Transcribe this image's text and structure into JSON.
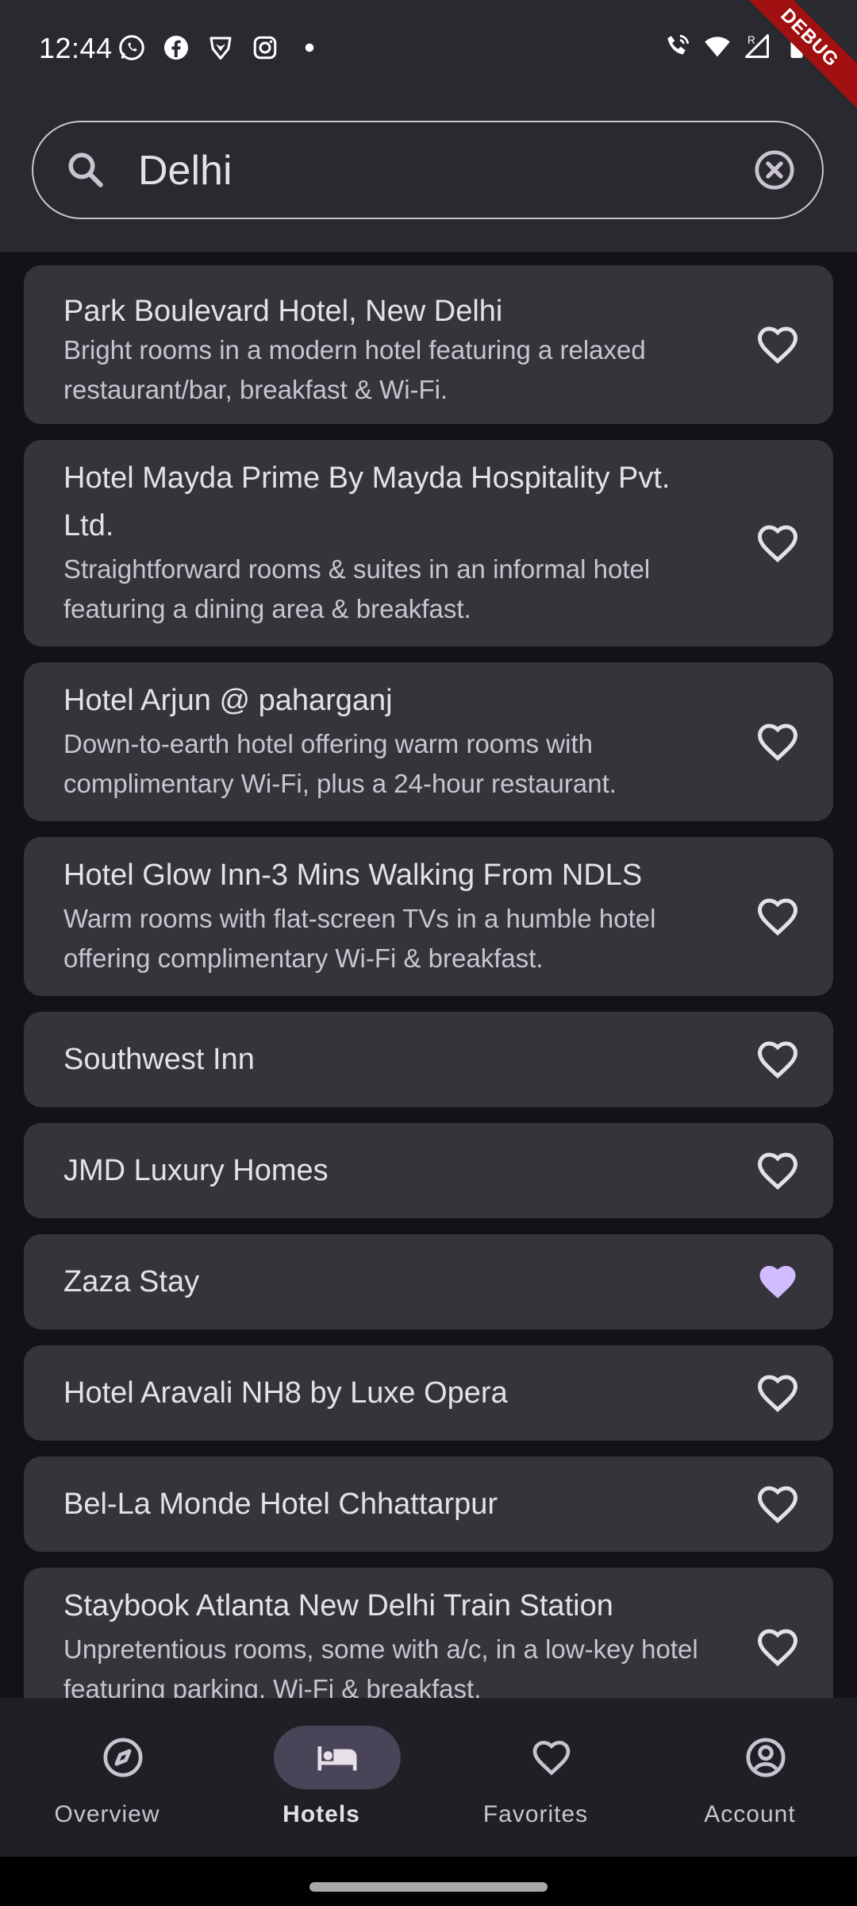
{
  "status_bar": {
    "time": "12:44",
    "left_icons": [
      "whatsapp-icon",
      "facebook-icon",
      "brave-icon",
      "instagram-icon",
      "dot-icon"
    ],
    "right_icons": [
      "wifi-call-icon",
      "wifi-icon",
      "signal-icon",
      "battery-icon"
    ],
    "debug_label": "DEBUG"
  },
  "search": {
    "value": "Delhi",
    "icon": "search-icon",
    "clear_icon": "clear-icon"
  },
  "hotels": [
    {
      "title": "Park Boulevard Hotel, New Delhi",
      "description": "Bright rooms in a modern hotel featuring a relaxed restaurant/bar, breakfast & Wi-Fi.",
      "favorite": false
    },
    {
      "title": "Hotel Mayda Prime By Mayda Hospitality Pvt. Ltd.",
      "description": "Straightforward rooms & suites in an informal hotel featuring a dining area & breakfast.",
      "favorite": false
    },
    {
      "title": "Hotel Arjun @ paharganj",
      "description": "Down-to-earth hotel offering warm rooms with complimentary Wi-Fi, plus a 24-hour restaurant.",
      "favorite": false
    },
    {
      "title": "Hotel Glow Inn-3 Mins Walking From NDLS",
      "description": "Warm rooms with flat-screen TVs in a humble hotel offering complimentary Wi-Fi & breakfast.",
      "favorite": false
    },
    {
      "title": "Southwest Inn",
      "description": "",
      "favorite": false
    },
    {
      "title": "JMD Luxury Homes",
      "description": "",
      "favorite": false
    },
    {
      "title": "Zaza Stay",
      "description": "",
      "favorite": true
    },
    {
      "title": "Hotel Aravali NH8 by Luxe Opera",
      "description": "",
      "favorite": false
    },
    {
      "title": "Bel-La Monde Hotel Chhattarpur",
      "description": "",
      "favorite": false
    },
    {
      "title": "Staybook Atlanta New Delhi Train Station",
      "description": "Unpretentious rooms, some with a/c, in a low-key hotel featuring parking, Wi-Fi & breakfast.",
      "favorite": false
    }
  ],
  "colors": {
    "favorite_active": "#d0bcff",
    "favorite_inactive": "#e6e0e9",
    "nav_active_pill": "#4a4458"
  },
  "bottom_nav": {
    "items": [
      {
        "label": "Overview",
        "icon": "compass-icon",
        "active": false
      },
      {
        "label": "Hotels",
        "icon": "bed-icon",
        "active": true
      },
      {
        "label": "Favorites",
        "icon": "heart-icon",
        "active": false
      },
      {
        "label": "Account",
        "icon": "account-icon",
        "active": false
      }
    ]
  }
}
